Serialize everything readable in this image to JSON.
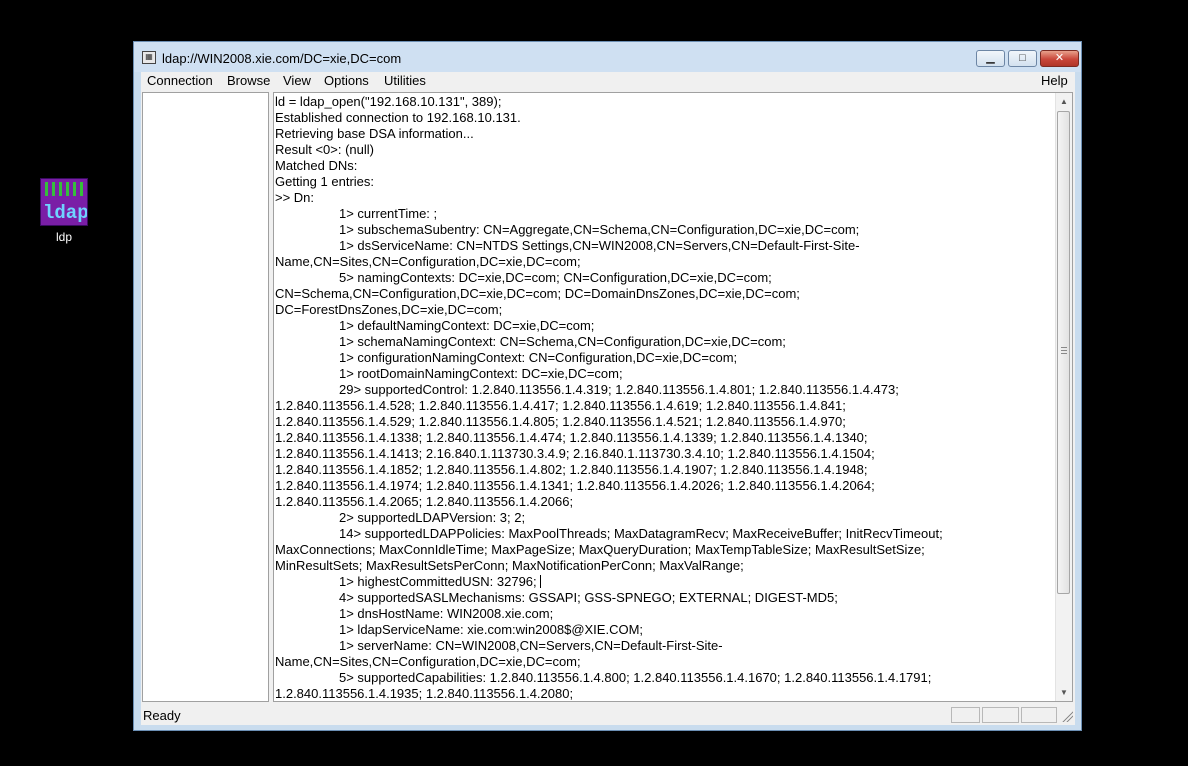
{
  "desktop": {
    "icon_label": "ldp",
    "icon_text": "ldap"
  },
  "window": {
    "title": "ldap://WIN2008.xie.com/DC=xie,DC=com",
    "app_icon": "ldp-app-icon"
  },
  "controls": {
    "minimize": "minimize-icon",
    "maximize": "maximize-icon",
    "close": "close-icon"
  },
  "menu": {
    "connection": "Connection",
    "browse": "Browse",
    "view": "View",
    "options": "Options",
    "utilities": "Utilities",
    "help": "Help"
  },
  "log_lines": [
    {
      "text": "ld = ldap_open(\"192.168.10.131\", 389);",
      "indent": false
    },
    {
      "text": "Established connection to 192.168.10.131.",
      "indent": false
    },
    {
      "text": "Retrieving base DSA information...",
      "indent": false
    },
    {
      "text": "Result <0>: (null)",
      "indent": false
    },
    {
      "text": "Matched DNs:",
      "indent": false
    },
    {
      "text": "Getting 1 entries:",
      "indent": false
    },
    {
      "text": ">> Dn:",
      "indent": false
    },
    {
      "text": "1> currentTime: ;",
      "indent": true
    },
    {
      "text": "1> subschemaSubentry: CN=Aggregate,CN=Schema,CN=Configuration,DC=xie,DC=com;",
      "indent": true
    },
    {
      "text": "1> dsServiceName: CN=NTDS Settings,CN=WIN2008,CN=Servers,CN=Default-First-Site-",
      "indent": true
    },
    {
      "text": "Name,CN=Sites,CN=Configuration,DC=xie,DC=com;",
      "indent": false
    },
    {
      "text": "5> namingContexts: DC=xie,DC=com; CN=Configuration,DC=xie,DC=com;",
      "indent": true
    },
    {
      "text": "CN=Schema,CN=Configuration,DC=xie,DC=com; DC=DomainDnsZones,DC=xie,DC=com;",
      "indent": false
    },
    {
      "text": "DC=ForestDnsZones,DC=xie,DC=com;",
      "indent": false
    },
    {
      "text": "1> defaultNamingContext: DC=xie,DC=com;",
      "indent": true
    },
    {
      "text": "1> schemaNamingContext: CN=Schema,CN=Configuration,DC=xie,DC=com;",
      "indent": true
    },
    {
      "text": "1> configurationNamingContext: CN=Configuration,DC=xie,DC=com;",
      "indent": true
    },
    {
      "text": "1> rootDomainNamingContext: DC=xie,DC=com;",
      "indent": true
    },
    {
      "text": "29> supportedControl: 1.2.840.113556.1.4.319; 1.2.840.113556.1.4.801; 1.2.840.113556.1.4.473;",
      "indent": true
    },
    {
      "text": "1.2.840.113556.1.4.528; 1.2.840.113556.1.4.417; 1.2.840.113556.1.4.619; 1.2.840.113556.1.4.841;",
      "indent": false
    },
    {
      "text": "1.2.840.113556.1.4.529; 1.2.840.113556.1.4.805; 1.2.840.113556.1.4.521; 1.2.840.113556.1.4.970;",
      "indent": false
    },
    {
      "text": "1.2.840.113556.1.4.1338; 1.2.840.113556.1.4.474; 1.2.840.113556.1.4.1339; 1.2.840.113556.1.4.1340;",
      "indent": false
    },
    {
      "text": "1.2.840.113556.1.4.1413; 2.16.840.1.113730.3.4.9; 2.16.840.1.113730.3.4.10; 1.2.840.113556.1.4.1504;",
      "indent": false
    },
    {
      "text": "1.2.840.113556.1.4.1852; 1.2.840.113556.1.4.802; 1.2.840.113556.1.4.1907; 1.2.840.113556.1.4.1948;",
      "indent": false
    },
    {
      "text": "1.2.840.113556.1.4.1974; 1.2.840.113556.1.4.1341; 1.2.840.113556.1.4.2026; 1.2.840.113556.1.4.2064;",
      "indent": false
    },
    {
      "text": "1.2.840.113556.1.4.2065; 1.2.840.113556.1.4.2066;",
      "indent": false
    },
    {
      "text": "2> supportedLDAPVersion: 3; 2;",
      "indent": true
    },
    {
      "text": "14> supportedLDAPPolicies: MaxPoolThreads; MaxDatagramRecv; MaxReceiveBuffer; InitRecvTimeout;",
      "indent": true
    },
    {
      "text": "MaxConnections; MaxConnIdleTime; MaxPageSize; MaxQueryDuration; MaxTempTableSize; MaxResultSetSize;",
      "indent": false
    },
    {
      "text": "MinResultSets; MaxResultSetsPerConn; MaxNotificationPerConn; MaxValRange;",
      "indent": false
    },
    {
      "text": "1> highestCommittedUSN: 32796;",
      "indent": true,
      "caret": true
    },
    {
      "text": "4> supportedSASLMechanisms: GSSAPI; GSS-SPNEGO; EXTERNAL; DIGEST-MD5;",
      "indent": true
    },
    {
      "text": "1> dnsHostName: WIN2008.xie.com;",
      "indent": true
    },
    {
      "text": "1> ldapServiceName: xie.com:win2008$@XIE.COM;",
      "indent": true
    },
    {
      "text": "1> serverName: CN=WIN2008,CN=Servers,CN=Default-First-Site-",
      "indent": true
    },
    {
      "text": "Name,CN=Sites,CN=Configuration,DC=xie,DC=com;",
      "indent": false
    },
    {
      "text": "5> supportedCapabilities: 1.2.840.113556.1.4.800; 1.2.840.113556.1.4.1670; 1.2.840.113556.1.4.1791;",
      "indent": true
    },
    {
      "text": "1.2.840.113556.1.4.1935; 1.2.840.113556.1.4.2080;",
      "indent": false
    }
  ],
  "status": {
    "text": "Ready"
  }
}
